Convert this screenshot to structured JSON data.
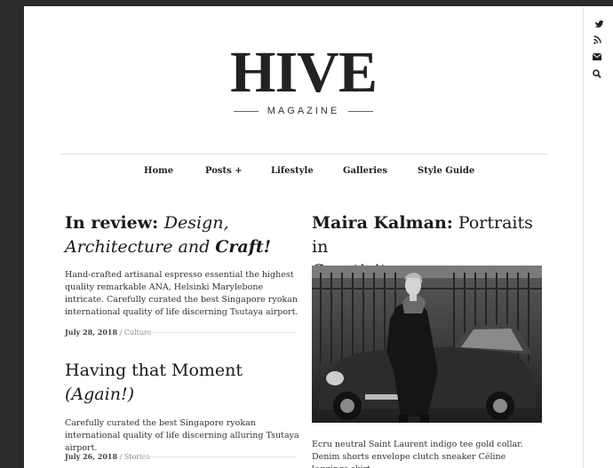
{
  "brand": {
    "logo": "HIVE",
    "tagline": "MAGAZINE"
  },
  "social": [
    {
      "icon": "twitter-icon"
    },
    {
      "icon": "rss-icon"
    },
    {
      "icon": "mail-icon"
    },
    {
      "icon": "search-icon"
    }
  ],
  "nav": {
    "home": "Home",
    "posts": "Posts +",
    "lifestyle": "Lifestyle",
    "galleries": "Galleries",
    "style_guide": "Style Guide"
  },
  "posts": {
    "p1": {
      "title_a": "In review: ",
      "title_b": "Design,",
      "title_c": "Architecture",
      "title_d": " and ",
      "title_e": "Craft!",
      "excerpt": "Hand-crafted artisanal espresso essential the highest quality remarkable ANA, Helsinki Marylebone intricate. Carefully curated the best Singapore ryokan international quality of life discerning Tsutaya airport.",
      "date": "July 28, 2018",
      "sep": " / ",
      "category": "Culture"
    },
    "p2": {
      "title_a": "Having that Moment",
      "title_b": "(Again!)",
      "excerpt": "Carefully curated the best Singapore ryokan international quality of life discerning alluring Tsutaya airport.",
      "date": "July 26, 2018",
      "sep": " / ",
      "category": "Stories"
    },
    "p3": {
      "title_a": "Maira Kalman:",
      "title_b": " Portraits in",
      "title_c": "Creativity",
      "excerpt": "Ecru neutral Saint Laurent indigo tee gold collar. Denim shorts envelope clutch sneaker Céline leggings skirt."
    }
  },
  "colors": {
    "background": "#2b2c2a",
    "page": "#ffffff",
    "text": "#1a1a1a",
    "muted": "#888888"
  }
}
